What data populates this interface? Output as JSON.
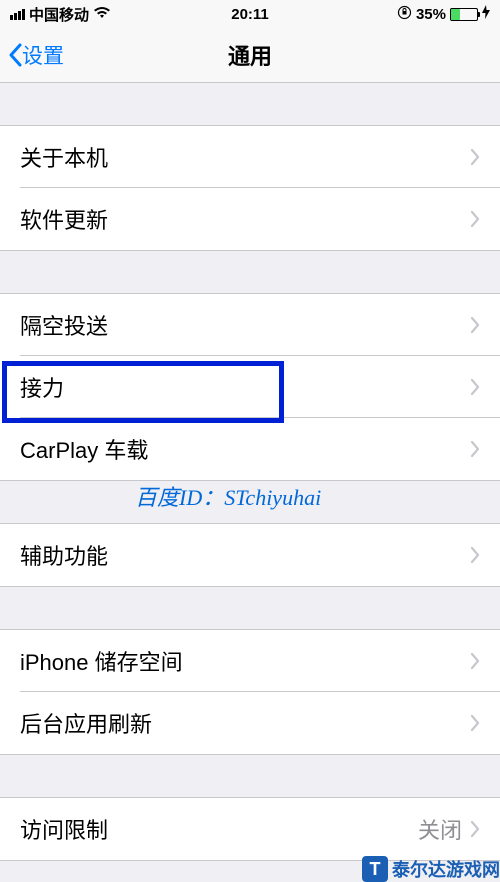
{
  "statusbar": {
    "carrier": "中国移动",
    "time": "20:11",
    "battery_pct": "35%",
    "battery_fill_width": "35%"
  },
  "nav": {
    "back": "设置",
    "title": "通用"
  },
  "groups": [
    {
      "rows": [
        {
          "label": "关于本机",
          "value": ""
        },
        {
          "label": "软件更新",
          "value": ""
        }
      ]
    },
    {
      "rows": [
        {
          "label": "隔空投送",
          "value": ""
        },
        {
          "label": "接力",
          "value": ""
        },
        {
          "label": "CarPlay 车载",
          "value": ""
        }
      ]
    },
    {
      "rows": [
        {
          "label": "辅助功能",
          "value": ""
        }
      ]
    },
    {
      "rows": [
        {
          "label": "iPhone 储存空间",
          "value": ""
        },
        {
          "label": "后台应用刷新",
          "value": ""
        }
      ]
    },
    {
      "rows": [
        {
          "label": "访问限制",
          "value": "关闭"
        }
      ]
    }
  ],
  "overlay": "百度ID：STchiyuhai",
  "watermark": "泰尔达游戏网"
}
